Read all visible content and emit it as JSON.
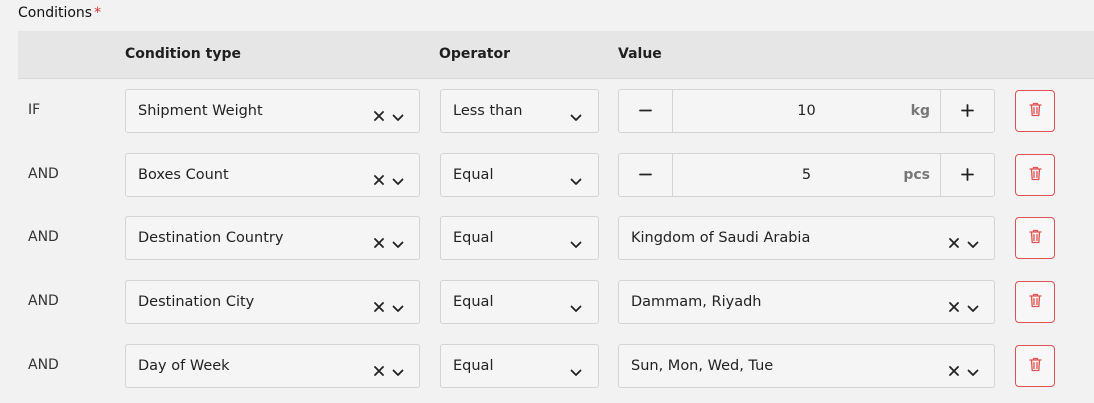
{
  "section": {
    "label": "Conditions",
    "required_mark": "*"
  },
  "columns": {
    "condition_type": "Condition type",
    "operator": "Operator",
    "value": "Value"
  },
  "colors": {
    "required": "#d32f2f",
    "delete": "#e05151"
  },
  "rows": [
    {
      "label": "IF",
      "condition_type": "Shipment Weight",
      "operator": "Less than",
      "value_kind": "stepper",
      "value": "10",
      "unit": "kg"
    },
    {
      "label": "AND",
      "condition_type": "Boxes Count",
      "operator": "Equal",
      "value_kind": "stepper",
      "value": "5",
      "unit": "pcs"
    },
    {
      "label": "AND",
      "condition_type": "Destination Country",
      "operator": "Equal",
      "value_kind": "select",
      "value": "Kingdom of Saudi Arabia"
    },
    {
      "label": "AND",
      "condition_type": "Destination City",
      "operator": "Equal",
      "value_kind": "select",
      "value": "Dammam, Riyadh"
    },
    {
      "label": "AND",
      "condition_type": "Day of Week",
      "operator": "Equal",
      "value_kind": "select",
      "value": "Sun, Mon, Wed, Tue"
    }
  ],
  "icons": {
    "clear": "close-icon",
    "dropdown": "chevron-down-icon",
    "minus": "minus-icon",
    "plus": "plus-icon",
    "delete": "trash-icon"
  }
}
